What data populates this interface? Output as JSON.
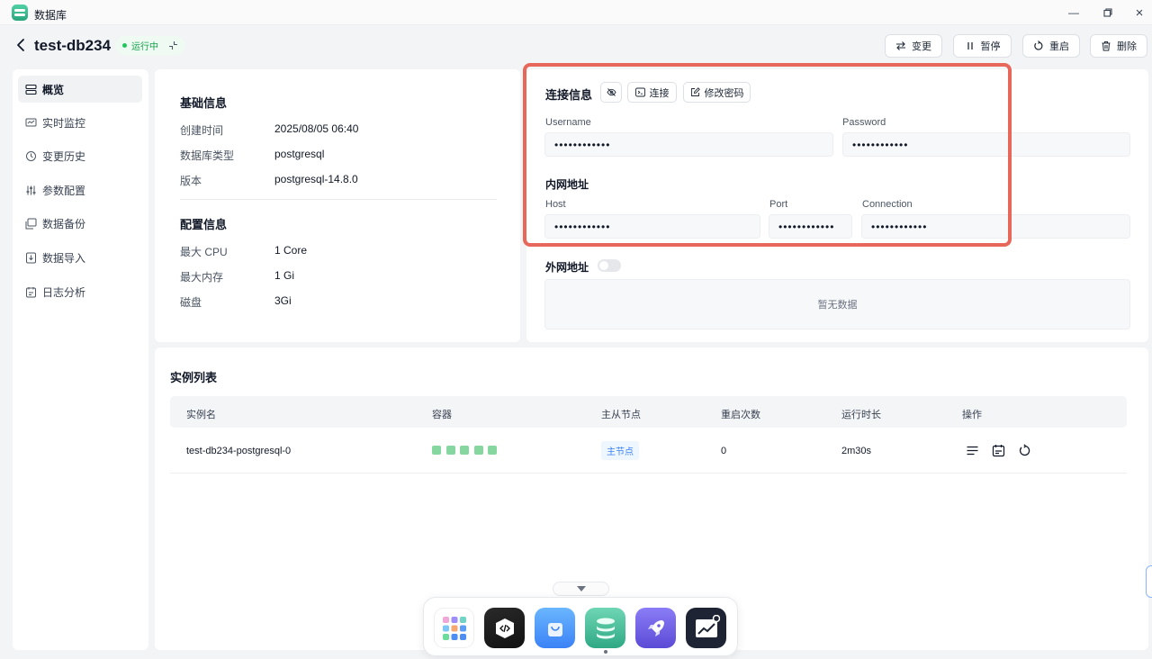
{
  "window": {
    "title": "数据库"
  },
  "header": {
    "db_name": "test-db234",
    "status": "运行中",
    "buttons": {
      "change": "变更",
      "pause": "暂停",
      "restart": "重启",
      "delete": "删除"
    }
  },
  "sidebar": {
    "items": [
      {
        "label": "概览",
        "icon": "overview-icon"
      },
      {
        "label": "实时监控",
        "icon": "monitor-icon"
      },
      {
        "label": "变更历史",
        "icon": "history-icon"
      },
      {
        "label": "参数配置",
        "icon": "sliders-icon"
      },
      {
        "label": "数据备份",
        "icon": "backup-icon"
      },
      {
        "label": "数据导入",
        "icon": "import-icon"
      },
      {
        "label": "日志分析",
        "icon": "log-icon"
      }
    ]
  },
  "basic": {
    "title": "基础信息",
    "rows": [
      {
        "label": "创建时间",
        "value": "2025/08/05 06:40"
      },
      {
        "label": "数据库类型",
        "value": "postgresql"
      },
      {
        "label": "版本",
        "value": "postgresql-14.8.0"
      }
    ]
  },
  "config": {
    "title": "配置信息",
    "rows": [
      {
        "label": "最大 CPU",
        "value": "1 Core"
      },
      {
        "label": "最大内存",
        "value": "1 Gi"
      },
      {
        "label": "磁盘",
        "value": "3Gi"
      }
    ]
  },
  "connection": {
    "title": "连接信息",
    "connect_label": "连接",
    "change_password_label": "修改密码",
    "username_label": "Username",
    "username_value": "••••••••••••",
    "password_label": "Password",
    "password_value": "••••••••••••",
    "internal_title": "内网地址",
    "host_label": "Host",
    "host_value": "••••••••••••",
    "port_label": "Port",
    "port_value": "••••••••••••",
    "connection_label": "Connection",
    "connection_value": "••••••••••••",
    "external_title": "外网地址",
    "external_empty": "暂无数据"
  },
  "instances": {
    "title": "实例列表",
    "columns": [
      "实例名",
      "容器",
      "主从节点",
      "重启次数",
      "运行时长",
      "操作"
    ],
    "rows": [
      {
        "name": "test-db234-postgresql-0",
        "containers": 5,
        "role": "主节点",
        "restarts": "0",
        "uptime": "2m30s"
      }
    ]
  },
  "colors": {
    "accent": "#e8675b",
    "running": "#22c55e",
    "container": "#86d6a0",
    "tag": "#3b82f6"
  }
}
